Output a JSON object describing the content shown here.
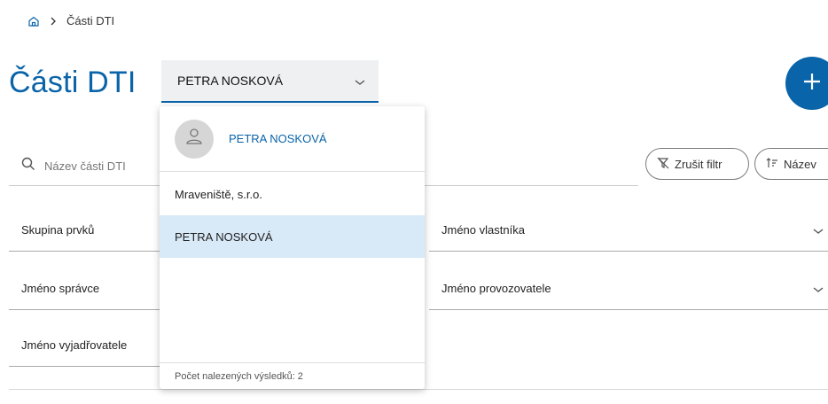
{
  "breadcrumb": {
    "home_icon": "home-icon",
    "separator_icon": "chevron-right-icon",
    "current": "Části DTI"
  },
  "page": {
    "title": "Části DTI"
  },
  "owner_select": {
    "value": "PETRA NOSKOVÁ",
    "icon": "chevron-down-icon"
  },
  "fab": {
    "icon": "plus-icon"
  },
  "search": {
    "placeholder": "Název části DTI",
    "icon": "search-icon"
  },
  "chips": {
    "clear_filter": "Zrušit filtr",
    "clear_filter_icon": "filter-off-icon",
    "sort": "Název",
    "sort_icon": "sort-icon"
  },
  "filters": {
    "group": "Skupina prvků",
    "owner_name": "Jméno vlastníka",
    "admin_name": "Jméno správce",
    "operator_name": "Jméno provozovatele",
    "respondent_name": "Jméno vyjadřovatele"
  },
  "dropdown": {
    "current_user": "PETRA NOSKOVÁ",
    "avatar_icon": "person-icon",
    "items": [
      {
        "label": "Mraveniště, s.r.o.",
        "selected": false
      },
      {
        "label": "PETRA NOSKOVÁ",
        "selected": true
      }
    ],
    "footer": "Počet nalezených výsledků: 2"
  },
  "colors": {
    "accent": "#0a64a9",
    "selected_bg": "#d8e9f7",
    "input_bg": "#eef0f2"
  }
}
